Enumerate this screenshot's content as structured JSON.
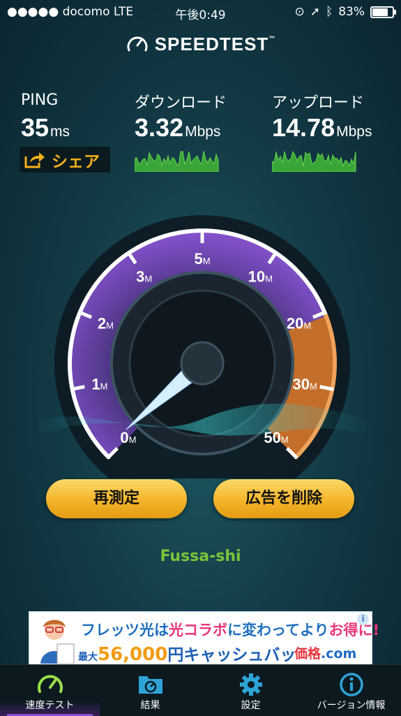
{
  "status_bar": {
    "carrier": "●●●●● docomo  LTE",
    "time": "午後0:49",
    "battery": "83%",
    "battery_level": 0.83
  },
  "header": {
    "brand": "SPEEDTEST",
    "trademark": "™"
  },
  "results": {
    "ping": {
      "label": "PING",
      "value": "35",
      "unit": "ms"
    },
    "download": {
      "label": "ダウンロード",
      "value": "3.32",
      "unit": "Mbps"
    },
    "upload": {
      "label": "アップロード",
      "value": "14.78",
      "unit": "Mbps"
    },
    "share_label": "シェア"
  },
  "gauge": {
    "scale_labels": [
      {
        "n": "0",
        "u": "M"
      },
      {
        "n": "1",
        "u": "M"
      },
      {
        "n": "2",
        "u": "M"
      },
      {
        "n": "3",
        "u": "M"
      },
      {
        "n": "5",
        "u": "M"
      },
      {
        "n": "10",
        "u": "M"
      },
      {
        "n": "20",
        "u": "M"
      },
      {
        "n": "30",
        "u": "M"
      },
      {
        "n": "50",
        "u": "M"
      }
    ],
    "needle_value_mbps": 0,
    "colors": {
      "arc": "#ffffff",
      "fill": "#7a46c8",
      "upload_fill": "#e07a2a",
      "needle": "#cfeaff"
    }
  },
  "buttons": {
    "retest": "再測定",
    "remove_ads": "広告を削除"
  },
  "server": {
    "location": "Fussa-shi"
  },
  "ad": {
    "line1_a": "フレッツ光は",
    "line1_b": "光コラボ",
    "line1_c": "に変わってより",
    "line1_d": "お得に!",
    "line2_a": "最大",
    "line2_amount": "56,000",
    "line2_b": "円キャッシュバック",
    "brand_a": "価格",
    "brand_b": ".com",
    "info": "i"
  },
  "tabs": [
    {
      "label": "速度テスト",
      "icon": "gauge-icon",
      "active": true
    },
    {
      "label": "結果",
      "icon": "folder-icon",
      "active": false
    },
    {
      "label": "設定",
      "icon": "gear-icon",
      "active": false
    },
    {
      "label": "バージョン情報",
      "icon": "info-icon",
      "active": false
    }
  ]
}
